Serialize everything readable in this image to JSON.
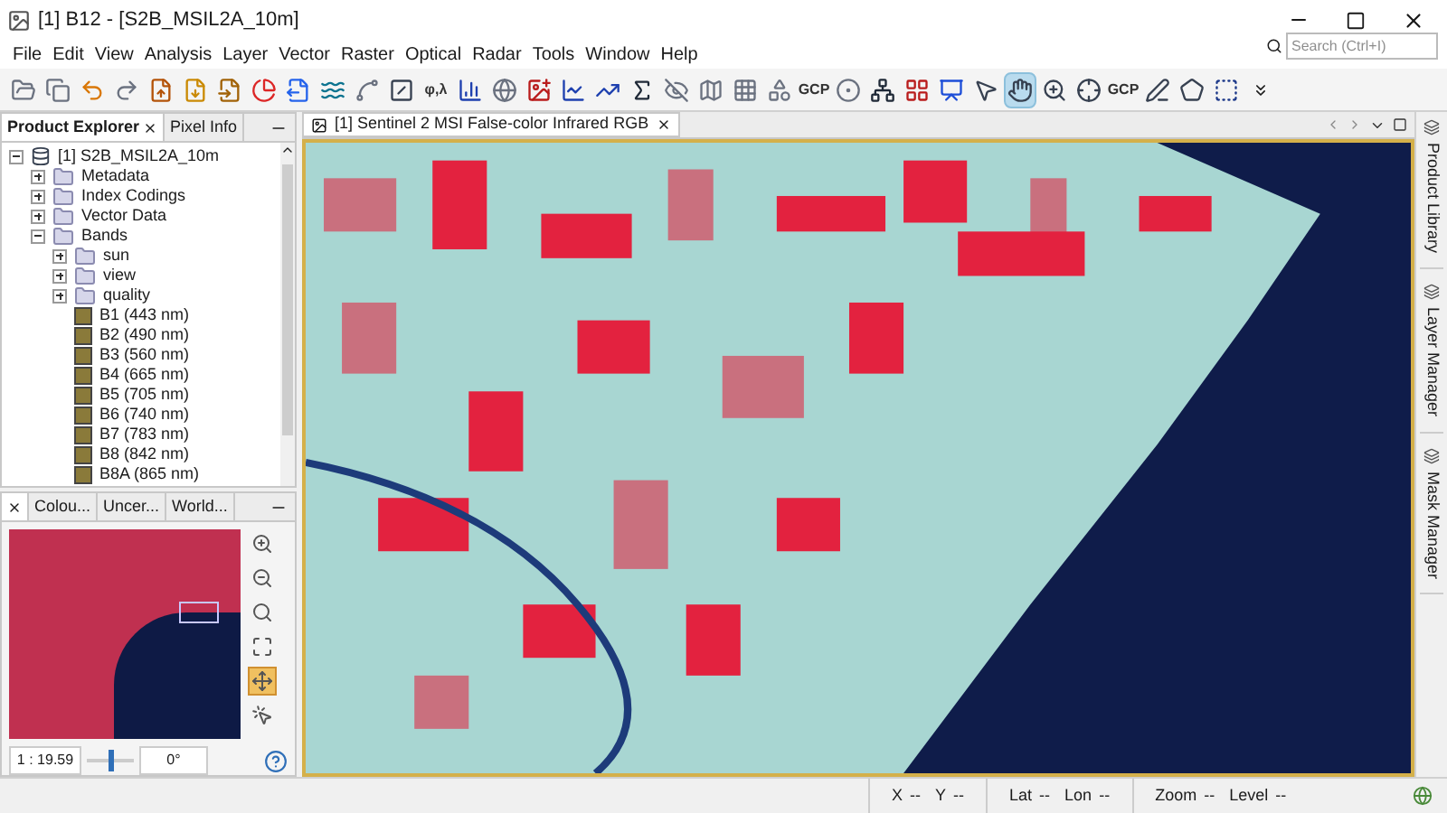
{
  "window": {
    "title": "[1] B12 - [S2B_MSIL2A_10m]"
  },
  "menu": [
    "File",
    "Edit",
    "View",
    "Analysis",
    "Layer",
    "Vector",
    "Raster",
    "Optical",
    "Radar",
    "Tools",
    "Window",
    "Help"
  ],
  "toolbar": [
    {
      "selected": false
    },
    {
      "selected": false
    },
    {
      "selected": false
    },
    {
      "selected": false
    },
    {
      "selected": false
    },
    {
      "selected": false
    },
    {
      "selected": false
    },
    {
      "selected": false
    },
    {
      "selected": false
    },
    {
      "selected": false
    },
    {
      "selected": false
    },
    {
      "selected": false
    },
    {
      "label": "φ,λ",
      "selected": false
    },
    {
      "selected": false
    },
    {
      "selected": false
    },
    {
      "selected": false
    },
    {
      "selected": false
    },
    {
      "selected": false
    },
    {
      "selected": false
    },
    {
      "selected": false
    },
    {
      "selected": false
    },
    {
      "selected": false
    },
    {
      "selected": false
    },
    {
      "label": "GCP",
      "selected": false
    },
    {
      "selected": false
    },
    {
      "selected": false
    },
    {
      "selected": false
    },
    {
      "selected": false
    },
    {
      "selected": false
    },
    {
      "selected": true
    },
    {
      "selected": false
    },
    {
      "selected": false
    },
    {
      "label": "GCP",
      "selected": false
    },
    {
      "selected": false
    },
    {
      "selected": false
    },
    {
      "selected": false
    }
  ],
  "search": {
    "placeholder": "Search (Ctrl+I)"
  },
  "explorer": {
    "tabs": [
      {
        "label": "Product Explorer",
        "closable": true,
        "selected": true
      },
      {
        "label": "Pixel Info",
        "closable": false,
        "selected": false
      }
    ],
    "tree": [
      {
        "label": "[1] S2B_MSIL2A_10m",
        "kind": "product",
        "expanded": true,
        "children": [
          {
            "label": "Metadata",
            "kind": "folder",
            "expanded": false
          },
          {
            "label": "Index Codings",
            "kind": "folder",
            "expanded": false
          },
          {
            "label": "Vector Data",
            "kind": "folder",
            "expanded": false
          },
          {
            "label": "Bands",
            "kind": "folder",
            "expanded": true,
            "children": [
              {
                "label": "sun",
                "kind": "folder",
                "expanded": false
              },
              {
                "label": "view",
                "kind": "folder",
                "expanded": false
              },
              {
                "label": "quality",
                "kind": "folder",
                "expanded": false
              },
              {
                "label": "B1 (443 nm)",
                "kind": "band"
              },
              {
                "label": "B2 (490 nm)",
                "kind": "band"
              },
              {
                "label": "B3 (560 nm)",
                "kind": "band"
              },
              {
                "label": "B4 (665 nm)",
                "kind": "band"
              },
              {
                "label": "B5 (705 nm)",
                "kind": "band"
              },
              {
                "label": "B6 (740 nm)",
                "kind": "band"
              },
              {
                "label": "B7 (783 nm)",
                "kind": "band"
              },
              {
                "label": "B8 (842 nm)",
                "kind": "band"
              },
              {
                "label": "B8A (865 nm)",
                "kind": "band"
              }
            ]
          }
        ]
      }
    ]
  },
  "navigation": {
    "tabs": [
      {
        "closable": true,
        "selected": true
      },
      {
        "label": "Colou...",
        "closable": false,
        "selected": false
      },
      {
        "label": "Uncer...",
        "closable": false,
        "selected": false
      },
      {
        "label": "World...",
        "closable": false,
        "selected": false
      }
    ],
    "tools": [
      {
        "selected": false
      },
      {
        "selected": false
      },
      {
        "selected": false
      },
      {
        "selected": false
      },
      {
        "selected": true
      },
      {
        "selected": false
      }
    ],
    "scale": "1 : 19.59",
    "slider": {
      "level": 0.5
    },
    "angle": "0°"
  },
  "document": {
    "tab": {
      "label": "[1] Sentinel 2 MSI False-color Infrared RGB",
      "selected": true
    }
  },
  "side_tabs": [
    "Product Library",
    "Layer Manager",
    "Mask Manager"
  ],
  "status_bar": [
    {
      "label": "X",
      "value": "--"
    },
    {
      "label": "Y",
      "value": "--"
    },
    {
      "label": "Lat",
      "value": "--"
    },
    {
      "label": "Lon",
      "value": "--"
    },
    {
      "label": "Zoom",
      "value": "--"
    },
    {
      "label": "Level",
      "value": "--"
    }
  ]
}
